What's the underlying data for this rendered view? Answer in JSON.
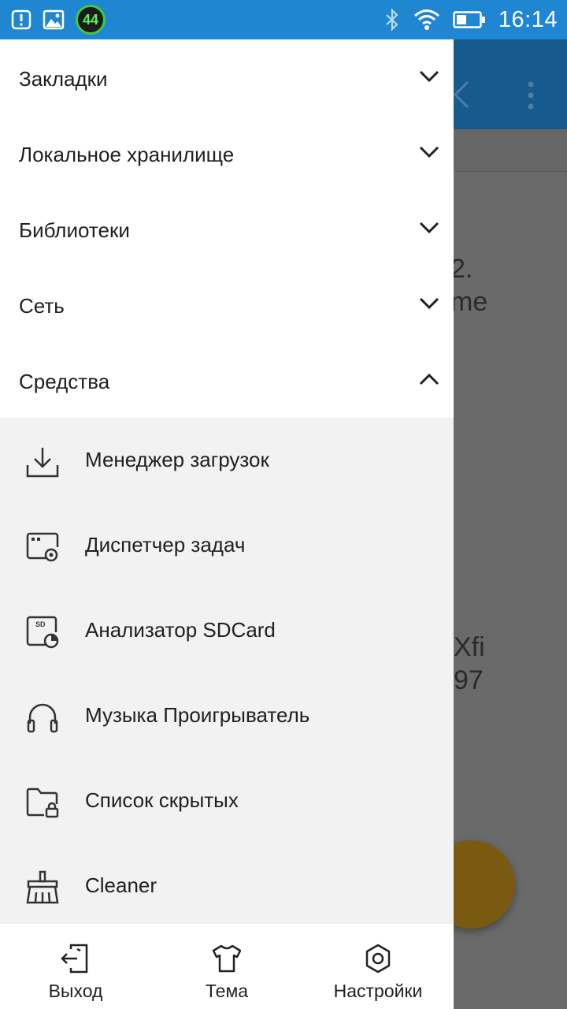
{
  "status_bar": {
    "time": "16:14",
    "badge_value": "44"
  },
  "background_app": {
    "fragments": [
      "2.",
      "me",
      "Xfi",
      "97"
    ]
  },
  "drawer": {
    "sections": [
      {
        "label": "Закладки",
        "expanded": false
      },
      {
        "label": "Локальное хранилище",
        "expanded": false
      },
      {
        "label": "Библиотеки",
        "expanded": false
      },
      {
        "label": "Сеть",
        "expanded": false
      },
      {
        "label": "Средства",
        "expanded": true
      }
    ],
    "tools": [
      {
        "label": "Менеджер загрузок",
        "icon": "download-icon"
      },
      {
        "label": "Диспетчер задач",
        "icon": "task-manager-icon"
      },
      {
        "label": "Анализатор SDCard",
        "icon": "sdcard-analyzer-icon"
      },
      {
        "label": "Музыка Проигрыватель",
        "icon": "headphones-icon"
      },
      {
        "label": "Список скрытых",
        "icon": "hidden-folder-icon"
      },
      {
        "label": "Cleaner",
        "icon": "broom-icon"
      }
    ],
    "bottom_bar": {
      "exit_label": "Выход",
      "theme_label": "Тема",
      "settings_label": "Настройки"
    }
  },
  "colors": {
    "status_bar": "#1f86d2",
    "drawer_bg": "#ffffff",
    "tools_bg": "#f2f2f2",
    "text": "#202020"
  }
}
